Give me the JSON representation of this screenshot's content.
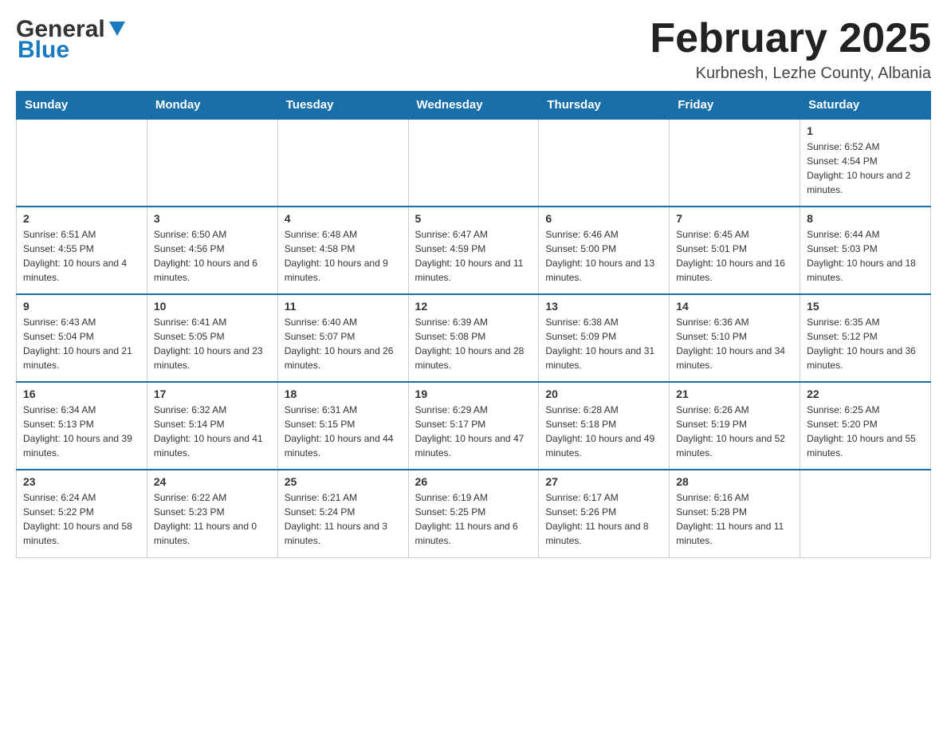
{
  "header": {
    "logo_general": "General",
    "logo_blue": "Blue",
    "month_title": "February 2025",
    "location": "Kurbnesh, Lezhe County, Albania"
  },
  "weekdays": [
    "Sunday",
    "Monday",
    "Tuesday",
    "Wednesday",
    "Thursday",
    "Friday",
    "Saturday"
  ],
  "weeks": [
    [
      {
        "day": "",
        "info": ""
      },
      {
        "day": "",
        "info": ""
      },
      {
        "day": "",
        "info": ""
      },
      {
        "day": "",
        "info": ""
      },
      {
        "day": "",
        "info": ""
      },
      {
        "day": "",
        "info": ""
      },
      {
        "day": "1",
        "info": "Sunrise: 6:52 AM\nSunset: 4:54 PM\nDaylight: 10 hours and 2 minutes."
      }
    ],
    [
      {
        "day": "2",
        "info": "Sunrise: 6:51 AM\nSunset: 4:55 PM\nDaylight: 10 hours and 4 minutes."
      },
      {
        "day": "3",
        "info": "Sunrise: 6:50 AM\nSunset: 4:56 PM\nDaylight: 10 hours and 6 minutes."
      },
      {
        "day": "4",
        "info": "Sunrise: 6:48 AM\nSunset: 4:58 PM\nDaylight: 10 hours and 9 minutes."
      },
      {
        "day": "5",
        "info": "Sunrise: 6:47 AM\nSunset: 4:59 PM\nDaylight: 10 hours and 11 minutes."
      },
      {
        "day": "6",
        "info": "Sunrise: 6:46 AM\nSunset: 5:00 PM\nDaylight: 10 hours and 13 minutes."
      },
      {
        "day": "7",
        "info": "Sunrise: 6:45 AM\nSunset: 5:01 PM\nDaylight: 10 hours and 16 minutes."
      },
      {
        "day": "8",
        "info": "Sunrise: 6:44 AM\nSunset: 5:03 PM\nDaylight: 10 hours and 18 minutes."
      }
    ],
    [
      {
        "day": "9",
        "info": "Sunrise: 6:43 AM\nSunset: 5:04 PM\nDaylight: 10 hours and 21 minutes."
      },
      {
        "day": "10",
        "info": "Sunrise: 6:41 AM\nSunset: 5:05 PM\nDaylight: 10 hours and 23 minutes."
      },
      {
        "day": "11",
        "info": "Sunrise: 6:40 AM\nSunset: 5:07 PM\nDaylight: 10 hours and 26 minutes."
      },
      {
        "day": "12",
        "info": "Sunrise: 6:39 AM\nSunset: 5:08 PM\nDaylight: 10 hours and 28 minutes."
      },
      {
        "day": "13",
        "info": "Sunrise: 6:38 AM\nSunset: 5:09 PM\nDaylight: 10 hours and 31 minutes."
      },
      {
        "day": "14",
        "info": "Sunrise: 6:36 AM\nSunset: 5:10 PM\nDaylight: 10 hours and 34 minutes."
      },
      {
        "day": "15",
        "info": "Sunrise: 6:35 AM\nSunset: 5:12 PM\nDaylight: 10 hours and 36 minutes."
      }
    ],
    [
      {
        "day": "16",
        "info": "Sunrise: 6:34 AM\nSunset: 5:13 PM\nDaylight: 10 hours and 39 minutes."
      },
      {
        "day": "17",
        "info": "Sunrise: 6:32 AM\nSunset: 5:14 PM\nDaylight: 10 hours and 41 minutes."
      },
      {
        "day": "18",
        "info": "Sunrise: 6:31 AM\nSunset: 5:15 PM\nDaylight: 10 hours and 44 minutes."
      },
      {
        "day": "19",
        "info": "Sunrise: 6:29 AM\nSunset: 5:17 PM\nDaylight: 10 hours and 47 minutes."
      },
      {
        "day": "20",
        "info": "Sunrise: 6:28 AM\nSunset: 5:18 PM\nDaylight: 10 hours and 49 minutes."
      },
      {
        "day": "21",
        "info": "Sunrise: 6:26 AM\nSunset: 5:19 PM\nDaylight: 10 hours and 52 minutes."
      },
      {
        "day": "22",
        "info": "Sunrise: 6:25 AM\nSunset: 5:20 PM\nDaylight: 10 hours and 55 minutes."
      }
    ],
    [
      {
        "day": "23",
        "info": "Sunrise: 6:24 AM\nSunset: 5:22 PM\nDaylight: 10 hours and 58 minutes."
      },
      {
        "day": "24",
        "info": "Sunrise: 6:22 AM\nSunset: 5:23 PM\nDaylight: 11 hours and 0 minutes."
      },
      {
        "day": "25",
        "info": "Sunrise: 6:21 AM\nSunset: 5:24 PM\nDaylight: 11 hours and 3 minutes."
      },
      {
        "day": "26",
        "info": "Sunrise: 6:19 AM\nSunset: 5:25 PM\nDaylight: 11 hours and 6 minutes."
      },
      {
        "day": "27",
        "info": "Sunrise: 6:17 AM\nSunset: 5:26 PM\nDaylight: 11 hours and 8 minutes."
      },
      {
        "day": "28",
        "info": "Sunrise: 6:16 AM\nSunset: 5:28 PM\nDaylight: 11 hours and 11 minutes."
      },
      {
        "day": "",
        "info": ""
      }
    ]
  ]
}
